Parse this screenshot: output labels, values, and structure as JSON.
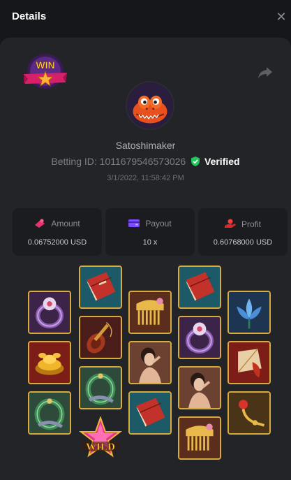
{
  "header": {
    "title": "Details",
    "close_icon": "close-icon"
  },
  "badge": {
    "text": "WIN"
  },
  "player": {
    "username": "Satoshimaker"
  },
  "bet": {
    "betting_id_label": "Betting ID:",
    "betting_id": "1011679546573026",
    "verified_label": "Verified",
    "datetime": "3/1/2022, 11:58:42 PM"
  },
  "stats": {
    "amount": {
      "label": "Amount",
      "value": "0.06752000 USD",
      "icon": "coins-icon"
    },
    "payout": {
      "label": "Payout",
      "value": "10 x",
      "icon": "wallet-icon"
    },
    "profit": {
      "label": "Profit",
      "value": "0.60768000 USD",
      "icon": "hand-coin-icon"
    }
  },
  "slot_grid": {
    "wild_text": "WILD",
    "colors": {
      "gold_border": "#d9aa3c",
      "red": "#9e2a24",
      "teal": "#1e5f6c",
      "purple": "#4a2b55",
      "brown": "#4a2a1c"
    },
    "columns": [
      {
        "column": 1,
        "symbols": [
          "ring",
          "gold-ingot",
          "jade-ring"
        ]
      },
      {
        "column": 2,
        "symbols": [
          "book",
          "pipa",
          "jade-ring",
          "wild"
        ]
      },
      {
        "column": 3,
        "symbols": [
          "comb",
          "lady",
          "book"
        ]
      },
      {
        "column": 4,
        "symbols": [
          "book",
          "ring",
          "lady",
          "comb"
        ]
      },
      {
        "column": 5,
        "symbols": [
          "lotus",
          "fan",
          "hairpin"
        ]
      }
    ]
  }
}
